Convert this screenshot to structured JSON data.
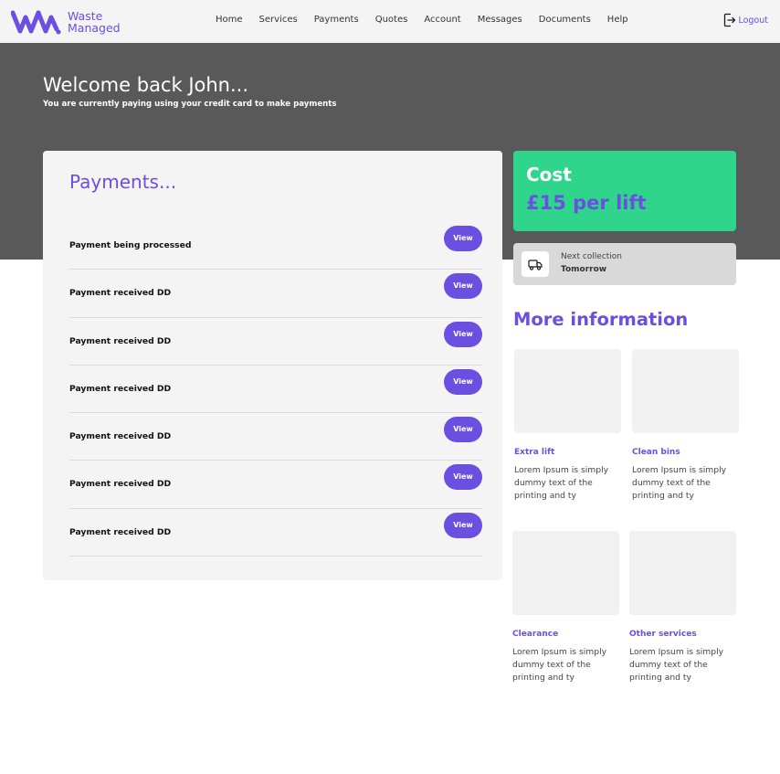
{
  "brand": {
    "name_line1": "Waste",
    "name_line2": "Managed",
    "accent": "#6a4fe0"
  },
  "nav": {
    "items": [
      "Home",
      "Services",
      "Payments",
      "Quotes",
      "Account",
      "Messages",
      "Documents",
      "Help"
    ],
    "logout_label": "Logout"
  },
  "hero": {
    "title": "Welcome back John...",
    "subtitle": "You are currently paying using your credit card to make payments",
    "background": "#595959"
  },
  "payments": {
    "title": "Payments...",
    "button_label": "View",
    "rows": [
      {
        "label": "Payment being processed"
      },
      {
        "label": "Payment received DD"
      },
      {
        "label": "Payment received DD"
      },
      {
        "label": "Payment received DD"
      },
      {
        "label": "Payment received DD"
      },
      {
        "label": "Payment received DD"
      },
      {
        "label": "Payment received DD"
      }
    ]
  },
  "cost": {
    "label": "Cost",
    "value": "£15 per lift",
    "background": "#30d58c"
  },
  "collection": {
    "label": "Next collection",
    "value": "Tomorrow",
    "icon": "truck-icon"
  },
  "more_info": {
    "title": "More information",
    "cards": [
      {
        "title": "Extra lift",
        "text": "Lorem Ipsum is simply dummy text of the printing and ty"
      },
      {
        "title": "Clean bins",
        "text": "Lorem Ipsum is simply dummy text of the printing and ty"
      },
      {
        "title": "Clearance",
        "text": "Lorem Ipsum is simply dummy text of the printing and ty"
      },
      {
        "title": "Other services",
        "text": "Lorem Ipsum is simply dummy text of the printing and ty"
      }
    ]
  }
}
